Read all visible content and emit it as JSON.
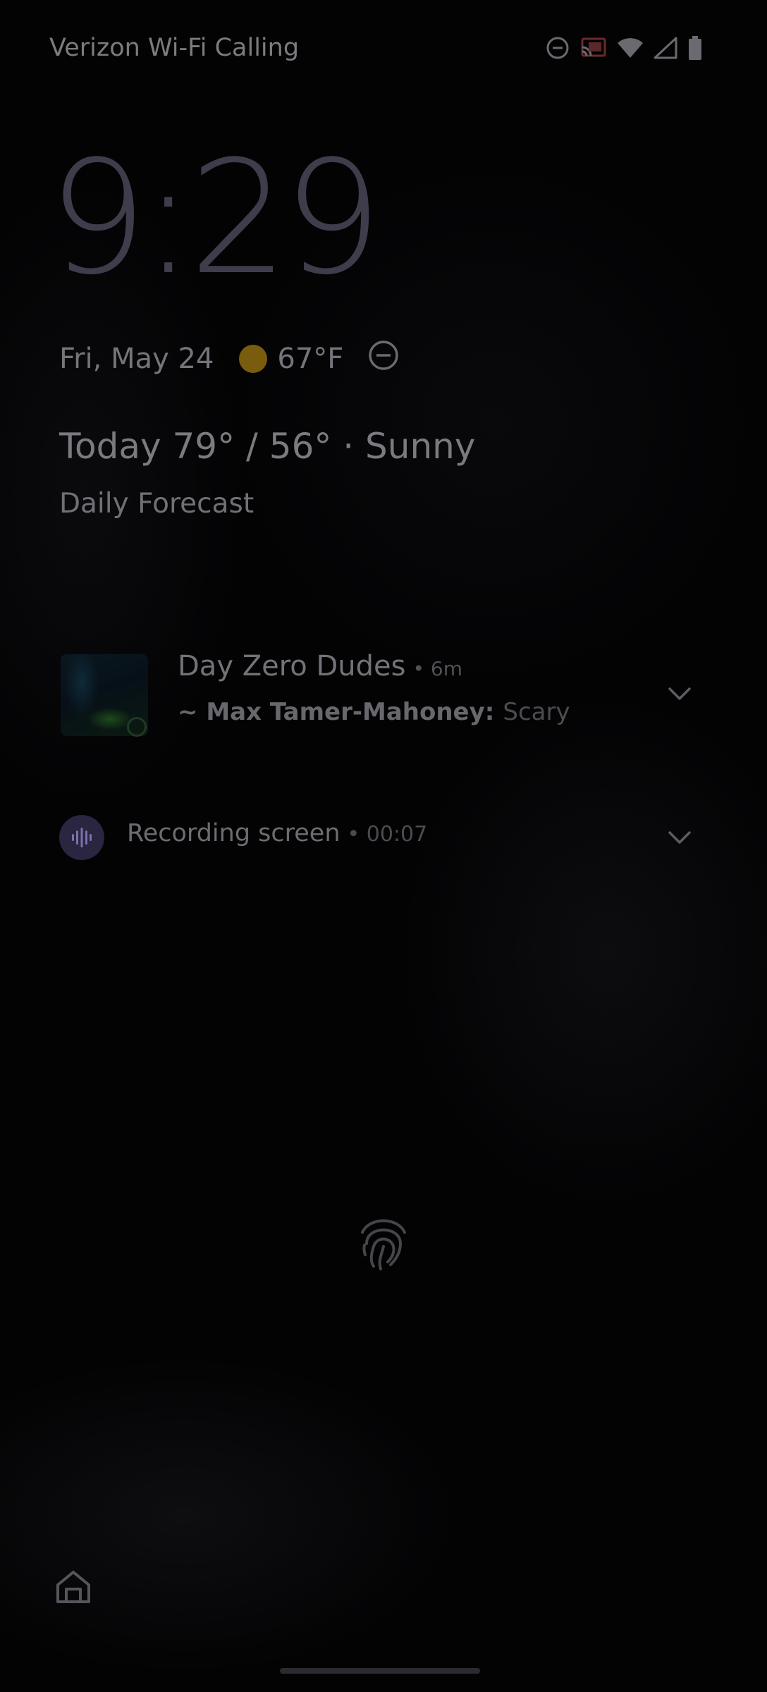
{
  "status_bar": {
    "carrier": "Verizon Wi-Fi Calling",
    "icons": [
      "do-not-disturb-icon",
      "cast-icon",
      "wifi-icon",
      "cellular-signal-icon",
      "battery-icon"
    ]
  },
  "lock_screen": {
    "clock": "9:29",
    "date": "Fri, May 24",
    "temperature": "67°F",
    "weather_icon": "sun-icon",
    "weather_today": "Today 79° / 56° · Sunny",
    "daily_forecast": "Daily Forecast"
  },
  "notifications": [
    {
      "title": "Day Zero Dudes",
      "time": "• 6m",
      "sender": "~ Max Tamer-Mahoney:",
      "message": "Scary",
      "app_icon": "whatsapp-icon"
    },
    {
      "title": "Recording screen",
      "time": "• 00:07",
      "app_icon": "audio-waveform-icon"
    }
  ],
  "bottom": {
    "unlock_icon": "fingerprint-icon",
    "shortcut_icon": "home-icon"
  },
  "colors": {
    "background": "#030304",
    "clock": "#3f3d4c",
    "sun": "#7a5c0f",
    "recording_badge": "#2a2540"
  }
}
